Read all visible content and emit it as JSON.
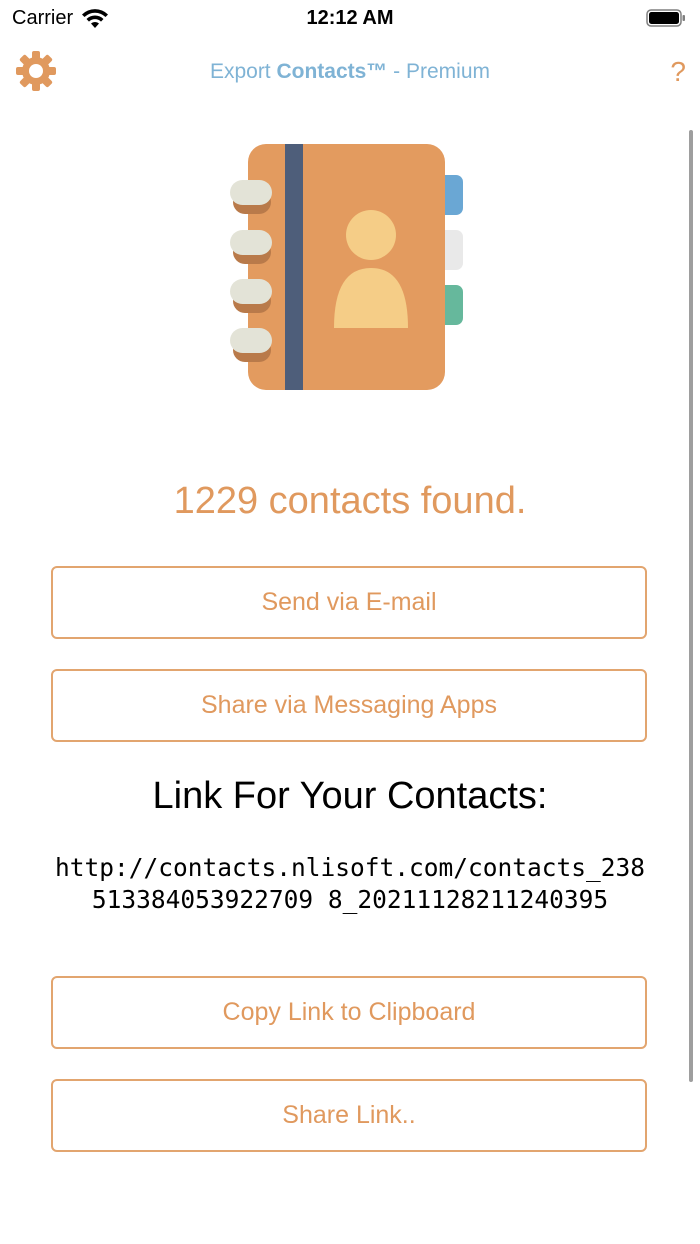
{
  "status_bar": {
    "carrier": "Carrier",
    "time": "12:12 AM"
  },
  "nav": {
    "title_prefix": "Export ",
    "title_bold": "Contacts™",
    "title_suffix": " - Premium",
    "help_label": "?"
  },
  "main": {
    "contacts_found": "1229 contacts found.",
    "send_email_label": "Send via E-mail",
    "share_messaging_label": "Share via Messaging Apps",
    "link_heading": "Link For Your Contacts:",
    "link_url": "http://contacts.nlisoft.com/contacts_238513384053922709 8_20211128211240395",
    "copy_link_label": "Copy Link to Clipboard",
    "share_link_label": "Share Link.."
  },
  "colors": {
    "accent": "#e0995e",
    "title_blue": "#7fb3d5"
  },
  "icons": {
    "settings": "gear-icon",
    "help": "question-mark-icon",
    "illustration": "address-book-icon"
  }
}
